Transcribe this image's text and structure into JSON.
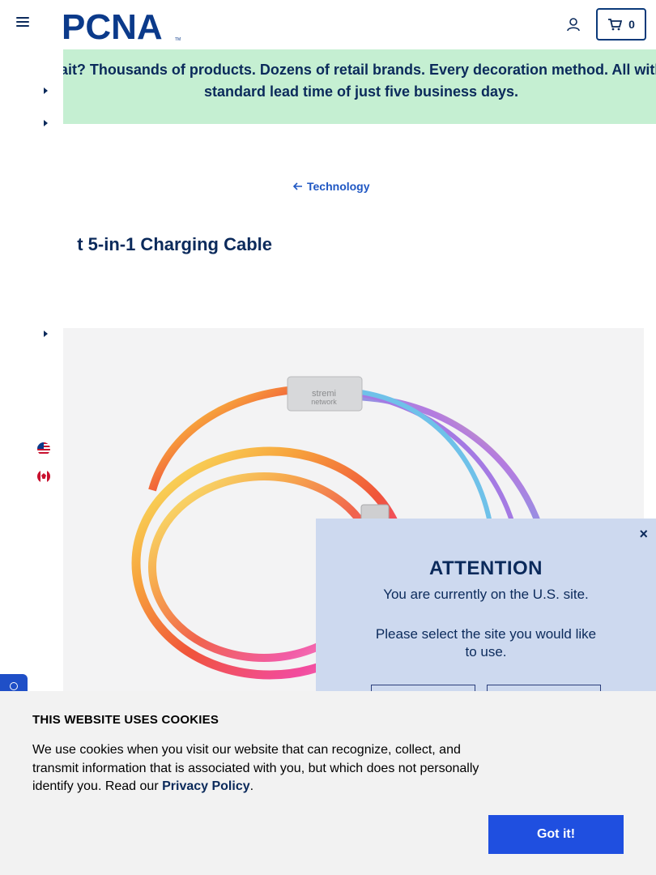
{
  "header": {
    "logo_text": "PCNA",
    "cart_count": "0"
  },
  "promo": {
    "text": "Wait? Thousands of products. Dozens of retail brands. Every decoration method. All with a standard lead time of just five business days."
  },
  "breadcrumb": {
    "label": "Technology"
  },
  "product": {
    "title": "t 5-in-1 Charging Cable",
    "connector_brand_line1": "stremi",
    "connector_brand_line2": "network"
  },
  "locale_modal": {
    "close": "×",
    "title": "ATTENTION",
    "current_site": "You are currently on the U.S. site.",
    "prompt": "Please select the site you would like to use."
  },
  "cookie_banner": {
    "title": "THIS WEBSITE USES COOKIES",
    "text": "We use cookies when you visit our website that can recognize, collect, and transmit information that is associated with you, but which does not personally identify you. Read our ",
    "link": "Privacy Policy",
    "after_link": ".",
    "accept": "Got it!"
  },
  "colors": {
    "navy": "#0b2a5b",
    "promo_bg": "#c5efd2",
    "accent_blue": "#1f4fe0",
    "modal_bg": "#cdd9ef",
    "cookie_bg": "#f2f2f2"
  },
  "icons": [
    "menu-icon",
    "user-icon",
    "cart-icon",
    "arrow-left-icon",
    "caret-right-icon",
    "us-flag-icon",
    "canada-flag-icon",
    "close-icon",
    "feedback-icon"
  ]
}
